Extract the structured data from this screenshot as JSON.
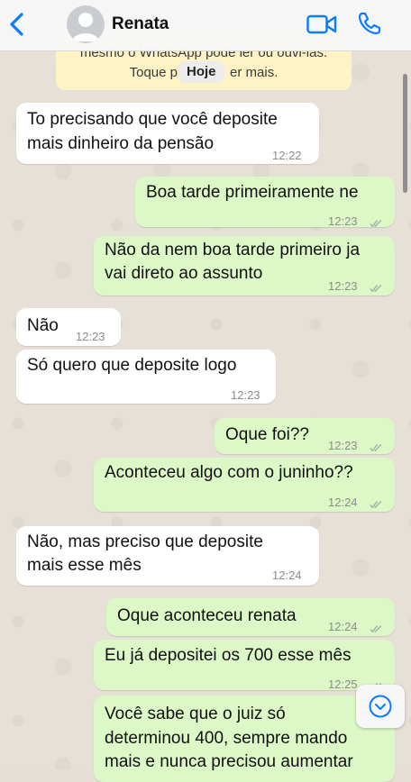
{
  "header": {
    "contact_name": "Renata",
    "icons": [
      "chevron-left-icon",
      "avatar",
      "video-camera-icon",
      "phone-icon"
    ],
    "accent_color": "#0a7cff"
  },
  "notice": {
    "line1": "mesmo o WhatsApp pode ler ou ouvi-las.",
    "line2_start": "Toque p",
    "line2_end": "er mais.",
    "background": "#fdf3c5"
  },
  "date_pill": "Hoje",
  "messages": [
    {
      "dir": "in",
      "lines": [
        "To precisando que você deposite",
        "mais dinheiro da pensão"
      ],
      "time": "12:22"
    },
    {
      "dir": "out",
      "lines": [
        "Boa tarde primeiramente ne"
      ],
      "time": "12:23",
      "read": true
    },
    {
      "dir": "out",
      "lines": [
        "Não da nem boa tarde primeiro ja",
        "vai direto ao assunto"
      ],
      "time": "12:23",
      "read": true
    },
    {
      "dir": "in",
      "lines": [
        "Não"
      ],
      "time": "12:23"
    },
    {
      "dir": "in",
      "lines": [
        "Só quero que deposite logo"
      ],
      "time": "12:23"
    },
    {
      "dir": "out",
      "lines": [
        "Oque foi??"
      ],
      "time": "12:23",
      "read": true
    },
    {
      "dir": "out",
      "lines": [
        "Aconteceu algo com o juninho??"
      ],
      "time": "12:24",
      "read": true
    },
    {
      "dir": "in",
      "lines": [
        "Não, mas preciso que deposite",
        "mais esse mês"
      ],
      "time": "12:24"
    },
    {
      "dir": "out",
      "lines": [
        "Oque aconteceu renata"
      ],
      "time": "12:24",
      "read": true
    },
    {
      "dir": "out",
      "lines": [
        "Eu já depositei os 700 esse mês"
      ],
      "time": "12:25",
      "read": true
    },
    {
      "dir": "out",
      "lines": [
        "Você sabe que o juiz só",
        "determinou 400, sempre mando",
        "mais e nunca precisou aumentar"
      ],
      "time": ""
    }
  ],
  "colors": {
    "incoming": "#ffffff",
    "outgoing": "#dcf8c6",
    "read_ticks": "#9bb2a6"
  }
}
